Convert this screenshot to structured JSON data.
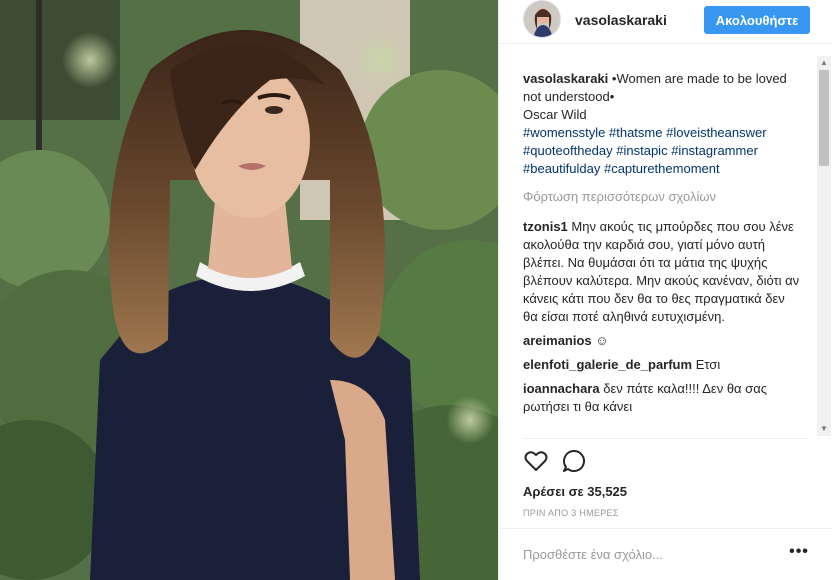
{
  "header": {
    "username": "vasolaskaraki",
    "follow_label": "Ακολουθήστε"
  },
  "caption": {
    "username": "vasolaskaraki",
    "line1": "•Women are made to be loved not understood•",
    "line2": "Oscar Wild",
    "hashtags": [
      "#womensstyle",
      "#thatsme",
      "#loveistheanswer",
      "#quoteoftheday",
      "#instapic",
      "#instagrammer",
      "#beautifulday",
      "#capturethemoment"
    ]
  },
  "load_more": "Φόρτωση περισσότερων σχολίων",
  "comments": [
    {
      "user": "tzonis1",
      "text": "Μην ακούς τις μπούρδες που σου λένε ακολούθα την καρδιά σου, γιατί μόνο αυτή βλέπει. Να θυμάσαι ότι τα μάτια της ψυχής βλέπουν καλύτερα. Μην ακούς κανέναν, διότι αν κάνεις κάτι που δεν θα το θες πραγματικά δεν θα είσαι ποτέ αληθινά ευτυχισμένη."
    },
    {
      "user": "areimanios",
      "text": "☺"
    },
    {
      "user": "elenfoti_galerie_de_parfum",
      "text": "Ετσι"
    },
    {
      "user": "ioannachara",
      "text": "δεν πάτε καλα!!!! Δεν θα σας ρωτήσει τι θα κάνει"
    }
  ],
  "likes": "Αρέσει σε 35,525",
  "timestamp": "ΠΡΙΝ ΑΠΟ 3 ΗΜΕΡΕΣ",
  "comment_box": {
    "placeholder": "Προσθέστε ένα σχόλιο...",
    "more_label": "•••"
  },
  "icons": {
    "like": "heart-icon",
    "comment": "speech-bubble-icon",
    "more": "ellipsis-icon"
  },
  "colors": {
    "accent": "#3897f0",
    "hashtag": "#003569",
    "muted": "#999999",
    "text": "#262626"
  }
}
